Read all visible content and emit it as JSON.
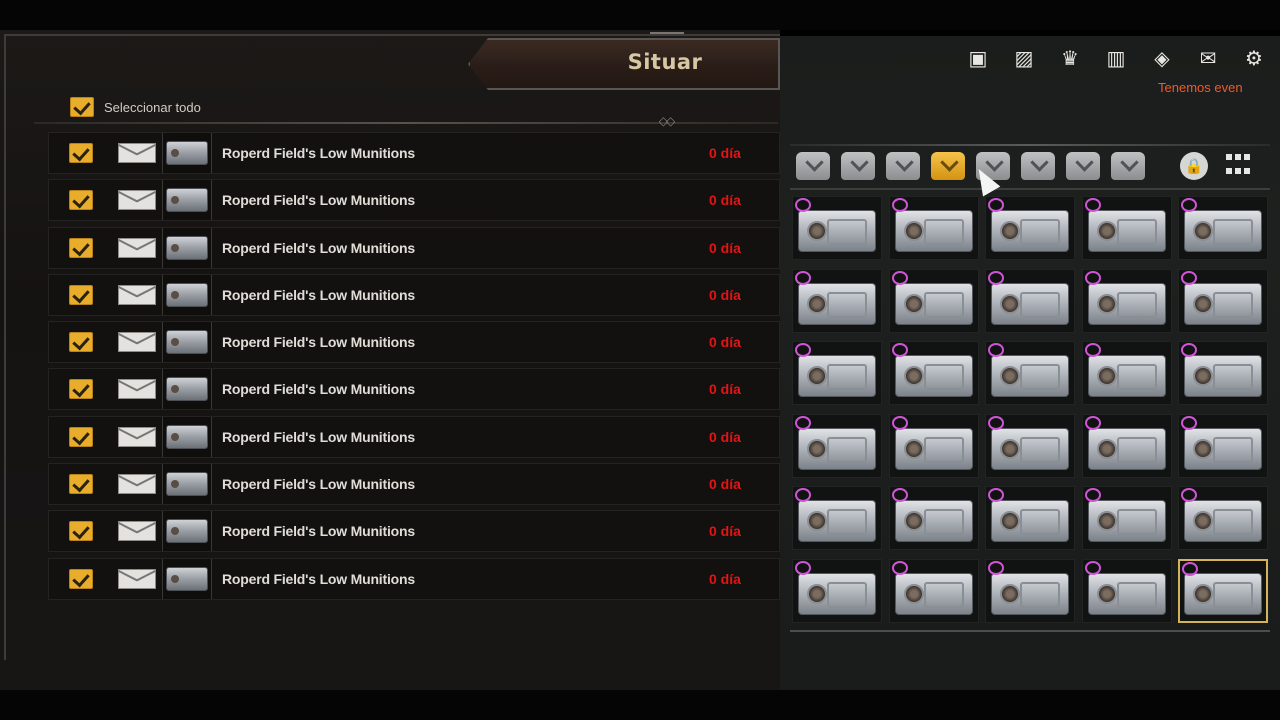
{
  "mail_panel": {
    "title": "Situar",
    "select_all_label": "Seleccionar todo",
    "select_all_checked": true,
    "items": [
      {
        "name": "Roperd Field's Low Munitions",
        "days": "0 día",
        "checked": true
      },
      {
        "name": "Roperd Field's Low Munitions",
        "days": "0 día",
        "checked": true
      },
      {
        "name": "Roperd Field's Low Munitions",
        "days": "0 día",
        "checked": true
      },
      {
        "name": "Roperd Field's Low Munitions",
        "days": "0 día",
        "checked": true
      },
      {
        "name": "Roperd Field's Low Munitions",
        "days": "0 día",
        "checked": true
      },
      {
        "name": "Roperd Field's Low Munitions",
        "days": "0 día",
        "checked": true
      },
      {
        "name": "Roperd Field's Low Munitions",
        "days": "0 día",
        "checked": true
      },
      {
        "name": "Roperd Field's Low Munitions",
        "days": "0 día",
        "checked": true
      },
      {
        "name": "Roperd Field's Low Munitions",
        "days": "0 día",
        "checked": true
      },
      {
        "name": "Roperd Field's Low Munitions",
        "days": "0 día",
        "checked": true
      }
    ]
  },
  "inventory_panel": {
    "event_text": "Tenemos even",
    "top_icons": [
      "notice-icon",
      "map-icon",
      "trophy-icon",
      "gift-icon",
      "academy-icon",
      "mail-icon",
      "settings-icon"
    ],
    "tabs": [
      {
        "icon": "bag-tab-icon",
        "active": false
      },
      {
        "icon": "bag-tab-icon",
        "active": false
      },
      {
        "icon": "bag-tab-icon",
        "active": false
      },
      {
        "icon": "bag-tab-icon",
        "active": true
      },
      {
        "icon": "bag-tab-icon",
        "active": false
      },
      {
        "icon": "bag-tab-icon",
        "active": false
      },
      {
        "icon": "bag-tab-icon",
        "active": false
      },
      {
        "icon": "bag-tab-icon",
        "active": false
      }
    ],
    "lock_icon": "lock-icon",
    "grid_icon": "grid-view-icon",
    "slot_count": 30,
    "selected_slot": 29,
    "slot_item": "ammo-crate",
    "timer_icon": "timer-icon"
  },
  "colors": {
    "accent_gold": "#e8ad2b",
    "days_red": "#e41414",
    "event_orange": "#ee5a2c",
    "timer_magenta": "#d054d6"
  }
}
